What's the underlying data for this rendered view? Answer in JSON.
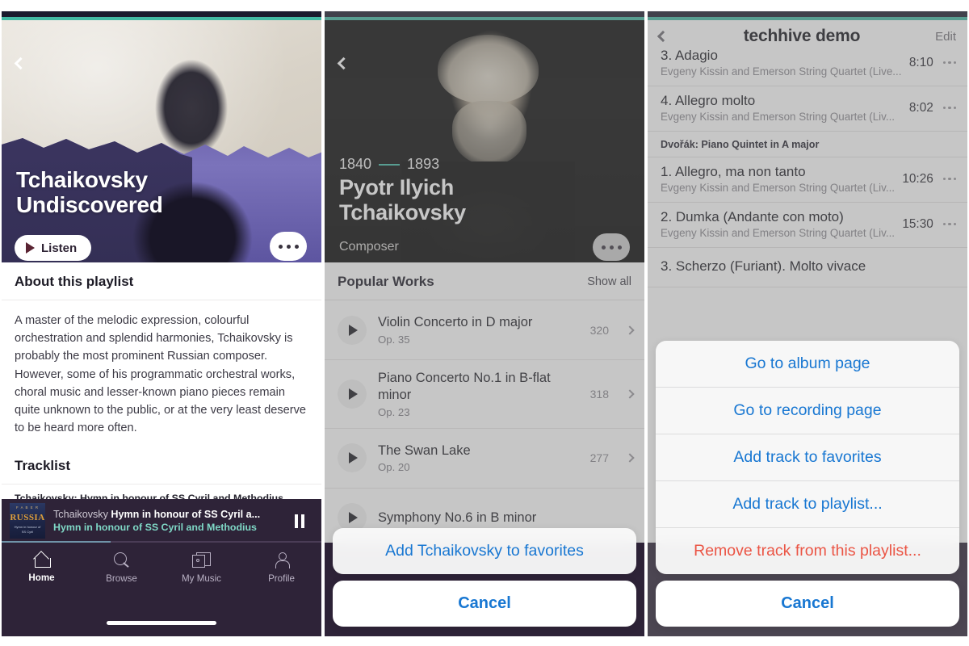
{
  "theme": {
    "accent_teal": "#43b9a4",
    "player_bg": "#2e2338",
    "ios_blue": "#1877d2",
    "destructive_red": "#eb5545",
    "statusbar": "#1b1a2e"
  },
  "panel1": {
    "back_icon": "chevron-left-icon",
    "hero": {
      "title_line1": "Tchaikovsky",
      "title_line2": "Undiscovered",
      "listen_label": "Listen",
      "listen_icon": "play-icon",
      "more_icon": "ellipsis-icon"
    },
    "about": {
      "heading": "About this playlist",
      "body": "A master of the melodic expression, colourful orchestration and splendid harmonies, Tchaikovsky is probably the most prominent Russian composer. However, some of his programmatic orchestral works, choral music and lesser-known piano pieces remain quite unknown to the public, or at the very least deserve to be heard more often."
    },
    "tracklist": {
      "heading": "Tracklist",
      "group_label": "Tchaikovsky: Hymn in honour of SS Cyril and Methodius"
    },
    "player": {
      "art_top": "F A B E R",
      "art_title": "RUSSIA",
      "art_sub": "Hymn in honour\nof SS Cyril",
      "now_playing_composer": "Tchaikovsky",
      "now_playing_work": "Hymn in honour of SS Cyril a...",
      "now_playing_sub": "Hymn in honour of SS Cyril and Methodius",
      "pause_icon": "pause-icon",
      "progress_percent": 34
    },
    "tabs": [
      {
        "label": "Home",
        "icon": "home-icon",
        "active": true
      },
      {
        "label": "Browse",
        "icon": "search-icon",
        "active": false
      },
      {
        "label": "My Music",
        "icon": "albums-icon",
        "active": false
      },
      {
        "label": "Profile",
        "icon": "person-icon",
        "active": false
      }
    ]
  },
  "panel2": {
    "back_icon": "chevron-left-icon",
    "hero": {
      "year_born": "1840",
      "year_died": "1893",
      "name_line1": "Pyotr Ilyich",
      "name_line2": "Tchaikovsky",
      "role": "Composer",
      "more_icon": "ellipsis-icon"
    },
    "popular_works": {
      "heading": "Popular Works",
      "show_all": "Show all",
      "items": [
        {
          "title": "Violin Concerto in D major",
          "opus": "Op. 35",
          "count": "320",
          "play_icon": "play-icon",
          "chevron": "chevron-right-icon"
        },
        {
          "title": "Piano Concerto No.1 in B-flat minor",
          "opus": "Op. 23",
          "count": "318",
          "play_icon": "play-icon",
          "chevron": "chevron-right-icon"
        },
        {
          "title": "The Swan Lake",
          "opus": "Op. 20",
          "count": "277",
          "play_icon": "play-icon",
          "chevron": "chevron-right-icon"
        },
        {
          "title": "Symphony No.6 in B minor",
          "opus": "",
          "count": "",
          "play_icon": "play-icon",
          "chevron": "chevron-right-icon"
        }
      ]
    },
    "action_sheet": {
      "items": [
        {
          "label": "Add Tchaikovsky to favorites",
          "style": "default"
        }
      ],
      "cancel_label": "Cancel"
    }
  },
  "panel3": {
    "back_icon": "chevron-left-icon",
    "nav": {
      "title": "techhive demo",
      "edit_label": "Edit"
    },
    "tracks_top": [
      {
        "title": "3. Adagio",
        "artist": "Evgeny Kissin and Emerson String Quartet (Live...",
        "duration": "8:10",
        "menu_icon": "ellipsis-icon"
      },
      {
        "title": "4. Allegro molto",
        "artist": "Evgeny Kissin and Emerson String Quartet (Liv...",
        "duration": "8:02",
        "menu_icon": "ellipsis-icon"
      }
    ],
    "group_label": "Dvořák: Piano Quintet in A major",
    "tracks_group": [
      {
        "title": "1. Allegro, ma non tanto",
        "artist": "Evgeny Kissin and Emerson String Quartet (Liv...",
        "duration": "10:26",
        "menu_icon": "ellipsis-icon"
      },
      {
        "title": "2. Dumka (Andante con moto)",
        "artist": "Evgeny Kissin and Emerson String Quartet (Liv...",
        "duration": "15:30",
        "menu_icon": "ellipsis-icon"
      },
      {
        "title": "3. Scherzo (Furiant). Molto vivace",
        "artist": "",
        "duration": "",
        "menu_icon": "ellipsis-icon"
      }
    ],
    "action_sheet": {
      "items": [
        {
          "label": "Go to album page",
          "style": "default"
        },
        {
          "label": "Go to recording page",
          "style": "default"
        },
        {
          "label": "Add track to favorites",
          "style": "default"
        },
        {
          "label": "Add track to playlist...",
          "style": "default"
        },
        {
          "label": "Remove track from this playlist...",
          "style": "destructive"
        }
      ],
      "cancel_label": "Cancel"
    }
  }
}
